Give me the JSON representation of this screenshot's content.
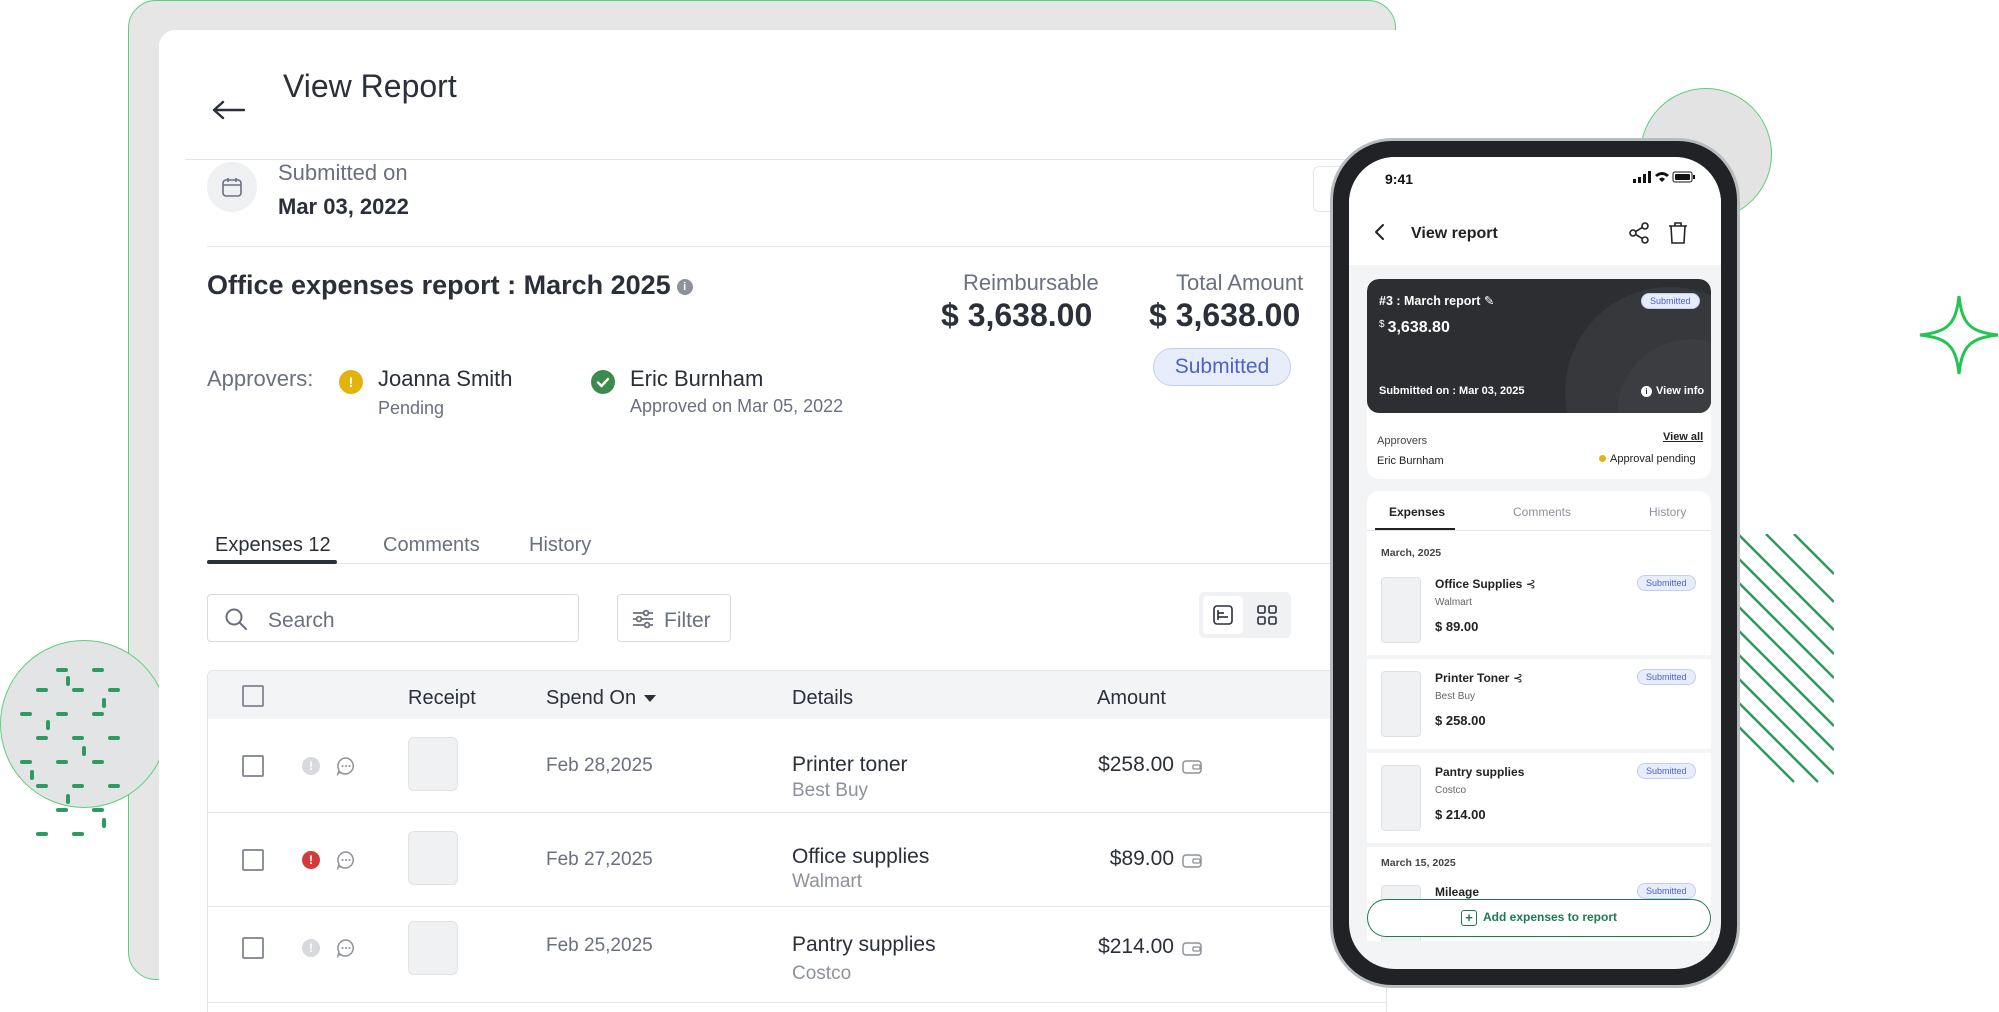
{
  "desktop": {
    "title": "View Report",
    "submitted_label": "Submitted on",
    "submitted_date": "Mar 03, 2022",
    "report_title": "Office expenses report : March 2025",
    "reimbursable_label": "Reimbursable",
    "reimbursable_amount": "$ 3,638.00",
    "total_label": "Total Amount",
    "total_amount": "$ 3,638.00",
    "status": "Submitted",
    "approvers_label": "Approvers:",
    "approvers": [
      {
        "name": "Joanna Smith",
        "status": "Pending",
        "icon": "pending-icon"
      },
      {
        "name": "Eric Burnham",
        "status": "Approved on Mar 05, 2022",
        "icon": "check-icon"
      }
    ],
    "tabs": [
      "Expenses 12",
      "Comments",
      "History"
    ],
    "search_placeholder": "Search",
    "filter_label": "Filter",
    "table": {
      "columns": [
        "Receipt",
        "Spend On",
        "Details",
        "Amount"
      ],
      "rows": [
        {
          "date": "Feb 28,2025",
          "title": "Printer toner",
          "merchant": "Best Buy",
          "amount": "$258.00",
          "flag": "info"
        },
        {
          "date": "Feb 27,2025",
          "title": "Office supplies",
          "merchant": "Walmart",
          "amount": "$89.00",
          "flag": "error"
        },
        {
          "date": "Feb 25,2025",
          "title": "Pantry supplies",
          "merchant": "Costco",
          "amount": "$214.00",
          "flag": "info"
        }
      ]
    }
  },
  "phone": {
    "time": "9:41",
    "title": "View report",
    "report_name": "#3 : March report",
    "badge": "Submitted",
    "currency": "$",
    "amount": "3,638.80",
    "submitted_on": "Submitted on : Mar 03, 2025",
    "view_info": "View info",
    "approvers_label": "Approvers",
    "view_all": "View all",
    "approver_name": "Eric Burnham",
    "approval_status": "Approval pending",
    "tabs": [
      "Expenses",
      "Comments",
      "History"
    ],
    "groups": [
      "March, 2025",
      "March 15, 2025"
    ],
    "items": [
      {
        "title": "Office Supplies",
        "merchant": "Walmart",
        "amount": "$ 89.00",
        "badge": "Submitted"
      },
      {
        "title": "Printer Toner",
        "merchant": "Best Buy",
        "amount": "$ 258.00",
        "badge": "Submitted"
      },
      {
        "title": "Pantry supplies",
        "merchant": "Costco",
        "amount": "$ 214.00",
        "badge": "Submitted"
      },
      {
        "title": "Mileage",
        "merchant": "",
        "amount": "",
        "badge": "Submitted"
      }
    ],
    "add_button": "Add expenses to report"
  },
  "colors": {
    "accent_green": "#1e7b4f",
    "status_blue": "#4b63c9",
    "pending_yellow": "#e2b30b",
    "approved_green": "#3d8a4e",
    "error_red": "#d23b3b"
  }
}
